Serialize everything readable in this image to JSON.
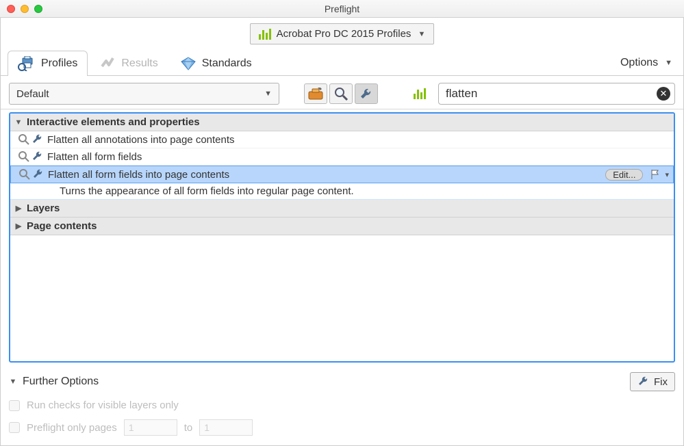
{
  "window": {
    "title": "Preflight"
  },
  "profile_bar": {
    "label": "Acrobat Pro DC 2015 Profiles"
  },
  "tabs": {
    "profiles": "Profiles",
    "results": "Results",
    "standards": "Standards"
  },
  "options_label": "Options",
  "select": {
    "value": "Default"
  },
  "search": {
    "value": "flatten"
  },
  "groups": {
    "g1": {
      "title": "Interactive elements and properties",
      "open": true,
      "items": [
        {
          "label": "Flatten all annotations into page contents"
        },
        {
          "label": "Flatten all form fields"
        },
        {
          "label": "Flatten all form fields into page contents",
          "selected": true,
          "edit_label": "Edit...",
          "description": "Turns the appearance of all form  fields into regular page content."
        }
      ]
    },
    "g2": {
      "title": "Layers",
      "open": false
    },
    "g3": {
      "title": "Page contents",
      "open": false
    }
  },
  "further": {
    "title": "Further Options",
    "fix_label": "Fix",
    "check_layers": "Run checks for visible layers only",
    "only_pages": "Preflight only pages",
    "from": "1",
    "to_label": "to",
    "to": "1"
  }
}
